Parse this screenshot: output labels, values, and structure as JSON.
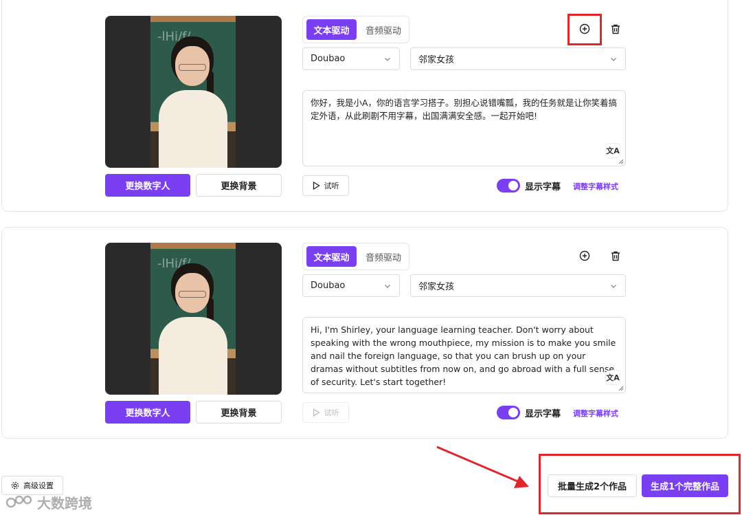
{
  "cards": [
    {
      "tabs": {
        "active": "文本驱动",
        "inactive": "音频驱动"
      },
      "model": "Doubao",
      "voice": "邻家女孩",
      "text": "你好，我是小A，你的语言学习搭子。别担心说错嘴瓢，我的任务就是让你笑着搞定外语，从此刷剧不用字幕，出国满满安全感。一起开始吧!",
      "change_avatar": "更换数字人",
      "change_bg": "更换背景",
      "listen": "试听",
      "subtitle_label": "显示字幕",
      "subtitle_on": true,
      "style_link": "调整字幕样式"
    },
    {
      "tabs": {
        "active": "文本驱动",
        "inactive": "音频驱动"
      },
      "model": "Doubao",
      "voice": "邻家女孩",
      "text": "Hi, I'm Shirley, your language learning teacher. Don't worry about speaking with the wrong mouthpiece, my mission is to make you smile and nail the foreign language, so that you can brush up on your dramas without subtitles from now on, and go abroad with a full sense of security. Let's start together!",
      "change_avatar": "更换数字人",
      "change_bg": "更换背景",
      "listen": "试听",
      "subtitle_label": "显示字幕",
      "subtitle_on": true,
      "style_link": "调整字幕样式"
    }
  ],
  "footer": {
    "advanced": "高级设置",
    "batch": "批量生成2个作品",
    "generate": "生成1个完整作品"
  },
  "watermark": "大数跨境",
  "colors": {
    "accent": "#7a3ff0",
    "highlight": "#e0262b"
  }
}
